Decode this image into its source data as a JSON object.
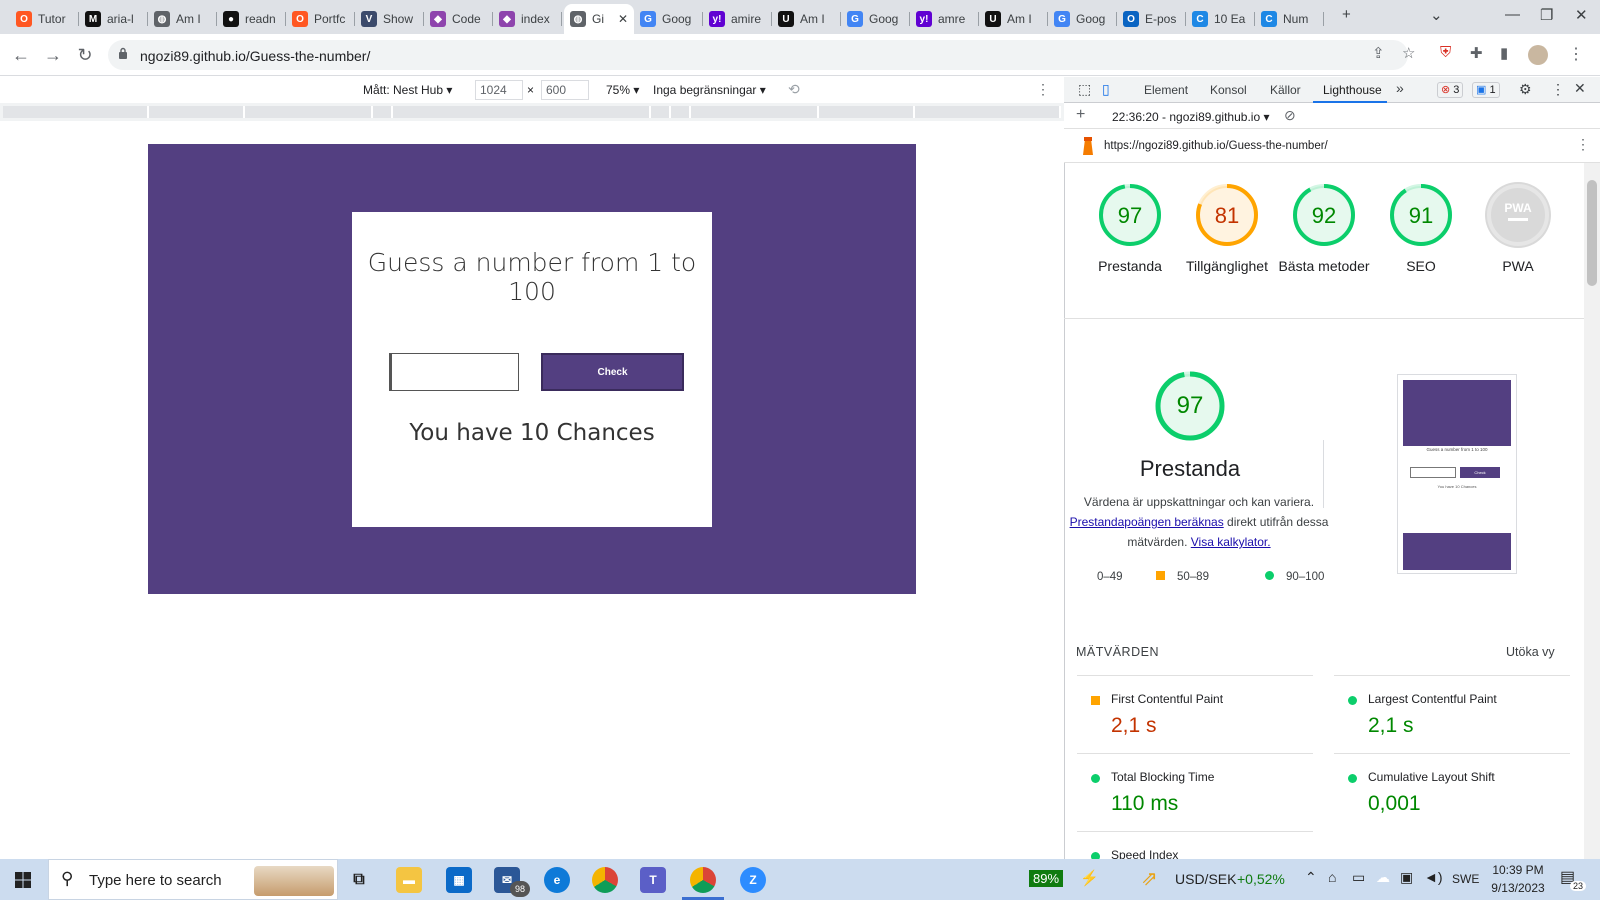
{
  "browser": {
    "tabs": [
      {
        "label": "Tutor",
        "icon": "o-icon",
        "color": "#ff5722",
        "glyph": "O"
      },
      {
        "label": "aria-l",
        "icon": "m-icon",
        "color": "#111111",
        "glyph": "M"
      },
      {
        "label": "Am I",
        "icon": "globe-icon",
        "color": "#5f6368",
        "glyph": "◍"
      },
      {
        "label": "readn",
        "icon": "github-icon",
        "color": "#111111",
        "glyph": "●"
      },
      {
        "label": "Portfc",
        "icon": "o-icon",
        "color": "#ff5722",
        "glyph": "O"
      },
      {
        "label": "Show",
        "icon": "v-icon",
        "color": "#3b4a6b",
        "glyph": "V"
      },
      {
        "label": "Code",
        "icon": "cube-icon",
        "color": "#8e44ad",
        "glyph": "◆"
      },
      {
        "label": "index",
        "icon": "cube-icon",
        "color": "#8e44ad",
        "glyph": "◆"
      },
      {
        "label": "Gi",
        "icon": "globe-icon",
        "color": "#5f6368",
        "glyph": "◍",
        "active": true
      },
      {
        "label": "Goog",
        "icon": "translate-icon",
        "color": "#4285f4",
        "glyph": "G"
      },
      {
        "label": "amire",
        "icon": "yahoo-icon",
        "color": "#6001d2",
        "glyph": "y!"
      },
      {
        "label": "Am I",
        "icon": "u-icon",
        "color": "#111111",
        "glyph": "U"
      },
      {
        "label": "Goog",
        "icon": "translate-icon",
        "color": "#4285f4",
        "glyph": "G"
      },
      {
        "label": "amre",
        "icon": "yahoo-icon",
        "color": "#6001d2",
        "glyph": "y!"
      },
      {
        "label": "Am I",
        "icon": "u-icon",
        "color": "#111111",
        "glyph": "U"
      },
      {
        "label": "Goog",
        "icon": "translate-icon",
        "color": "#4285f4",
        "glyph": "G"
      },
      {
        "label": "E-pos",
        "icon": "outlook-icon",
        "color": "#0a64c2",
        "glyph": "O"
      },
      {
        "label": "10 Ea",
        "icon": "c-icon",
        "color": "#1e88e5",
        "glyph": "C"
      },
      {
        "label": "Num",
        "icon": "c-icon",
        "color": "#1e88e5",
        "glyph": "C"
      }
    ],
    "new_tab": "+",
    "url": "ngozi89.github.io/Guess-the-number/"
  },
  "device_toolbar": {
    "device": "Mått: Nest Hub",
    "width": "1024",
    "height": "600",
    "times": "×",
    "zoom": "75%",
    "throttle": "Inga begränsningar"
  },
  "game": {
    "title": "Guess a number from 1 to 100",
    "input_value": "",
    "check_label": "Check",
    "chances_text": "You have 10 Chances"
  },
  "devtools": {
    "tabs": [
      "Element",
      "Konsol",
      "Källor",
      "Lighthouse"
    ],
    "more": "»",
    "error_count": "3",
    "message_count": "1",
    "report_time": "22:36:20 - ngozi89.github.io",
    "report_url": "https://ngozi89.github.io/Guess-the-number/",
    "scores": [
      {
        "label": "Prestanda",
        "value": 97,
        "display": "97",
        "color": "#0cce6b",
        "text_color": "#008800",
        "bg": "#e6f9ee"
      },
      {
        "label": "Tillgänglighet",
        "value": 81,
        "display": "81",
        "color": "#ffa400",
        "text_color": "#c33300",
        "bg": "#fff3e0"
      },
      {
        "label": "Bästa metoder",
        "value": 92,
        "display": "92",
        "color": "#0cce6b",
        "text_color": "#008800",
        "bg": "#e6f9ee"
      },
      {
        "label": "SEO",
        "value": 91,
        "display": "91",
        "color": "#0cce6b",
        "text_color": "#008800",
        "bg": "#e6f9ee"
      },
      {
        "label": "PWA",
        "value": null,
        "display": "PWA",
        "color": "#d9d9d9",
        "text_color": "#ffffff",
        "bg": "#e6e6e6"
      }
    ],
    "big_score": "97",
    "big_label": "Prestanda",
    "note_text": "Värdena är uppskattningar och kan variera.",
    "note_link1": "Prestandapoängen beräknas",
    "note_mid": " direkt utifrån dessa mätvärden. ",
    "note_link2": "Visa kalkylator.",
    "legend": [
      "0–49",
      "50–89",
      "90–100"
    ],
    "thumb_title": "Guess a number from 1 to 100",
    "thumb_button": "Check",
    "thumb_chances": "You have 10 Chances",
    "metrics_header": "MÄTVÄRDEN",
    "expand": "Utöka vy",
    "metrics": [
      {
        "name": "First Contentful Paint",
        "value": "2,1 s",
        "status": "average",
        "color": "#c33300"
      },
      {
        "name": "Largest Contentful Paint",
        "value": "2,1 s",
        "status": "pass",
        "color": "#008800"
      },
      {
        "name": "Total Blocking Time",
        "value": "110 ms",
        "status": "pass",
        "color": "#008800"
      },
      {
        "name": "Cumulative Layout Shift",
        "value": "0,001",
        "status": "pass",
        "color": "#008800"
      },
      {
        "name": "Speed Index",
        "value": "",
        "status": "pass",
        "color": "#008800"
      }
    ]
  },
  "taskbar": {
    "search_placeholder": "Type here to search",
    "mail_badge": "98",
    "battery": "89%",
    "stock_name": "USD/SEK",
    "stock_change": "+0,52%",
    "language": "SWE",
    "time": "10:39 PM",
    "date": "9/13/2023",
    "notifications": "23"
  }
}
